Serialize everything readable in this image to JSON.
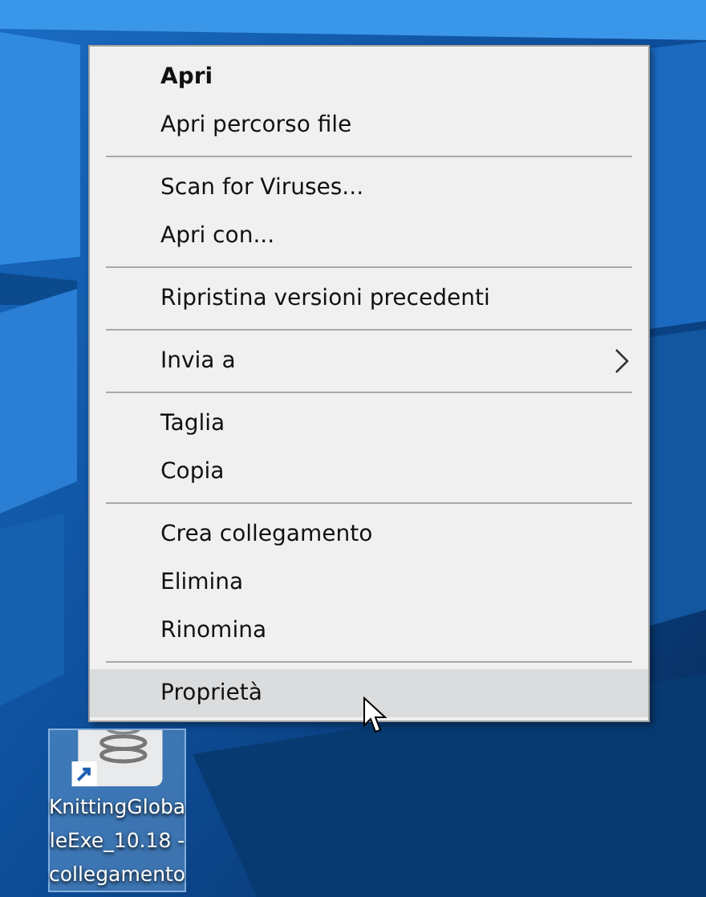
{
  "desktop_icon": {
    "label_lines": [
      "KnittingGloba",
      "leExe_10.18 -",
      "collegamento"
    ],
    "selected": true
  },
  "context_menu": {
    "groups": [
      {
        "items": [
          {
            "label": "Apri",
            "kind": "default",
            "selected": false
          },
          {
            "label": "Apri percorso file",
            "kind": "normal",
            "selected": false
          }
        ]
      },
      {
        "items": [
          {
            "label": "Scan for Viruses...",
            "kind": "normal",
            "selected": false
          },
          {
            "label": "Apri con...",
            "kind": "normal",
            "selected": false
          }
        ]
      },
      {
        "items": [
          {
            "label": "Ripristina versioni precedenti",
            "kind": "normal",
            "selected": false
          }
        ]
      },
      {
        "items": [
          {
            "label": "Invia a",
            "kind": "submenu",
            "selected": false
          }
        ]
      },
      {
        "items": [
          {
            "label": "Taglia",
            "kind": "normal",
            "selected": false
          },
          {
            "label": "Copia",
            "kind": "normal",
            "selected": false
          }
        ]
      },
      {
        "items": [
          {
            "label": "Crea collegamento",
            "kind": "normal",
            "selected": false
          },
          {
            "label": "Elimina",
            "kind": "normal",
            "selected": false
          },
          {
            "label": "Rinomina",
            "kind": "normal",
            "selected": false
          }
        ]
      },
      {
        "items": [
          {
            "label": "Proprietà",
            "kind": "normal",
            "selected": true
          }
        ]
      }
    ]
  }
}
